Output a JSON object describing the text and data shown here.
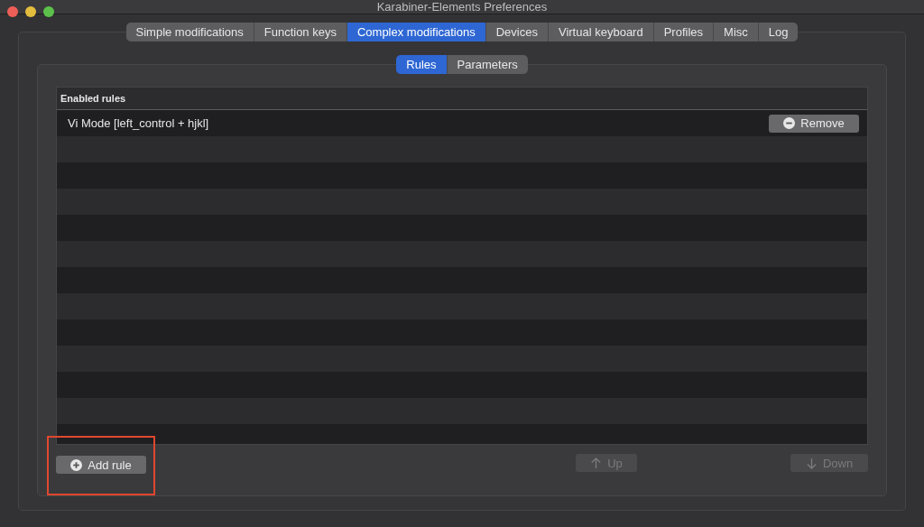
{
  "window": {
    "title": "Karabiner-Elements Preferences"
  },
  "tabs": [
    {
      "label": "Simple modifications",
      "selected": false
    },
    {
      "label": "Function keys",
      "selected": false
    },
    {
      "label": "Complex modifications",
      "selected": true
    },
    {
      "label": "Devices",
      "selected": false
    },
    {
      "label": "Virtual keyboard",
      "selected": false
    },
    {
      "label": "Profiles",
      "selected": false
    },
    {
      "label": "Misc",
      "selected": false
    },
    {
      "label": "Log",
      "selected": false
    }
  ],
  "subtabs": [
    {
      "label": "Rules",
      "selected": true
    },
    {
      "label": "Parameters",
      "selected": false
    }
  ],
  "table": {
    "columns": [
      "Enabled rules"
    ],
    "rows": [
      {
        "name": "Vi Mode [left_control + hjkl]",
        "button": "Remove"
      }
    ]
  },
  "buttons": [
    {
      "label": "Add rule",
      "kind": "add",
      "disabled": false,
      "highlighted": true
    },
    {
      "label": "Up",
      "kind": "up",
      "disabled": true
    },
    {
      "label": "Down",
      "kind": "down",
      "disabled": true
    }
  ]
}
